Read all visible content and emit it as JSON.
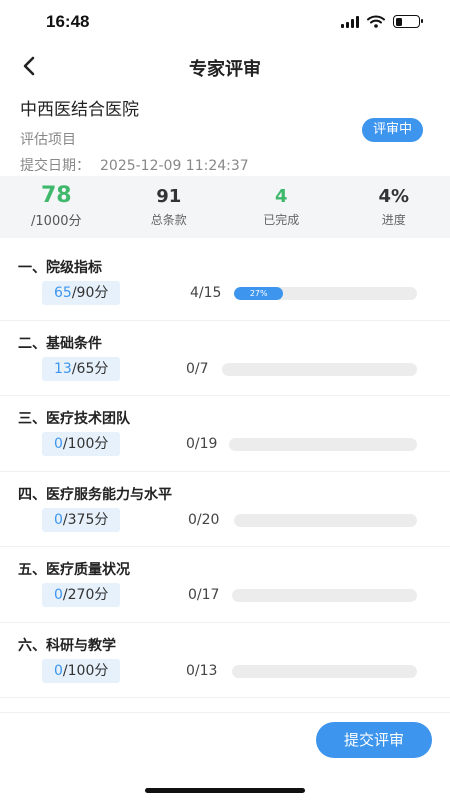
{
  "status_bar": {
    "time": "16:48",
    "battery_level": 0.3
  },
  "nav": {
    "title": "专家评审"
  },
  "info": {
    "hospital": "中西医结合医院",
    "project_label": "评估项目",
    "date_label": "提交日期：",
    "date_value": "2025-12-09 11:24:37",
    "status": "评审中"
  },
  "stats": {
    "score": "78",
    "score_total": "/1000分",
    "total_items": "91",
    "total_items_label": "总条款",
    "completed": "4",
    "completed_label": "已完成",
    "progress": "4%",
    "progress_label": "进度"
  },
  "sections": [
    {
      "title": "一、院级指标",
      "score": "65",
      "max": "/90分",
      "count": "4/15",
      "progress_label": "27%",
      "progress": 0.27
    },
    {
      "title": "二、基础条件",
      "score": "13",
      "max": "/65分",
      "count": "0/7",
      "progress_label": "",
      "progress": 0
    },
    {
      "title": "三、医疗技术团队",
      "score": "0",
      "max": "/100分",
      "count": "0/19",
      "progress_label": "",
      "progress": 0
    },
    {
      "title": "四、医疗服务能力与水平",
      "score": "0",
      "max": "/375分",
      "count": "0/20",
      "progress_label": "",
      "progress": 0
    },
    {
      "title": "五、医疗质量状况",
      "score": "0",
      "max": "/270分",
      "count": "0/17",
      "progress_label": "",
      "progress": 0
    },
    {
      "title": "六、科研与教学",
      "score": "0",
      "max": "/100分",
      "count": "0/13",
      "progress_label": "",
      "progress": 0
    }
  ],
  "footer": {
    "submit_label": "提交评审"
  },
  "colors": {
    "accent": "#3d95ee",
    "success": "#3fb86c"
  }
}
